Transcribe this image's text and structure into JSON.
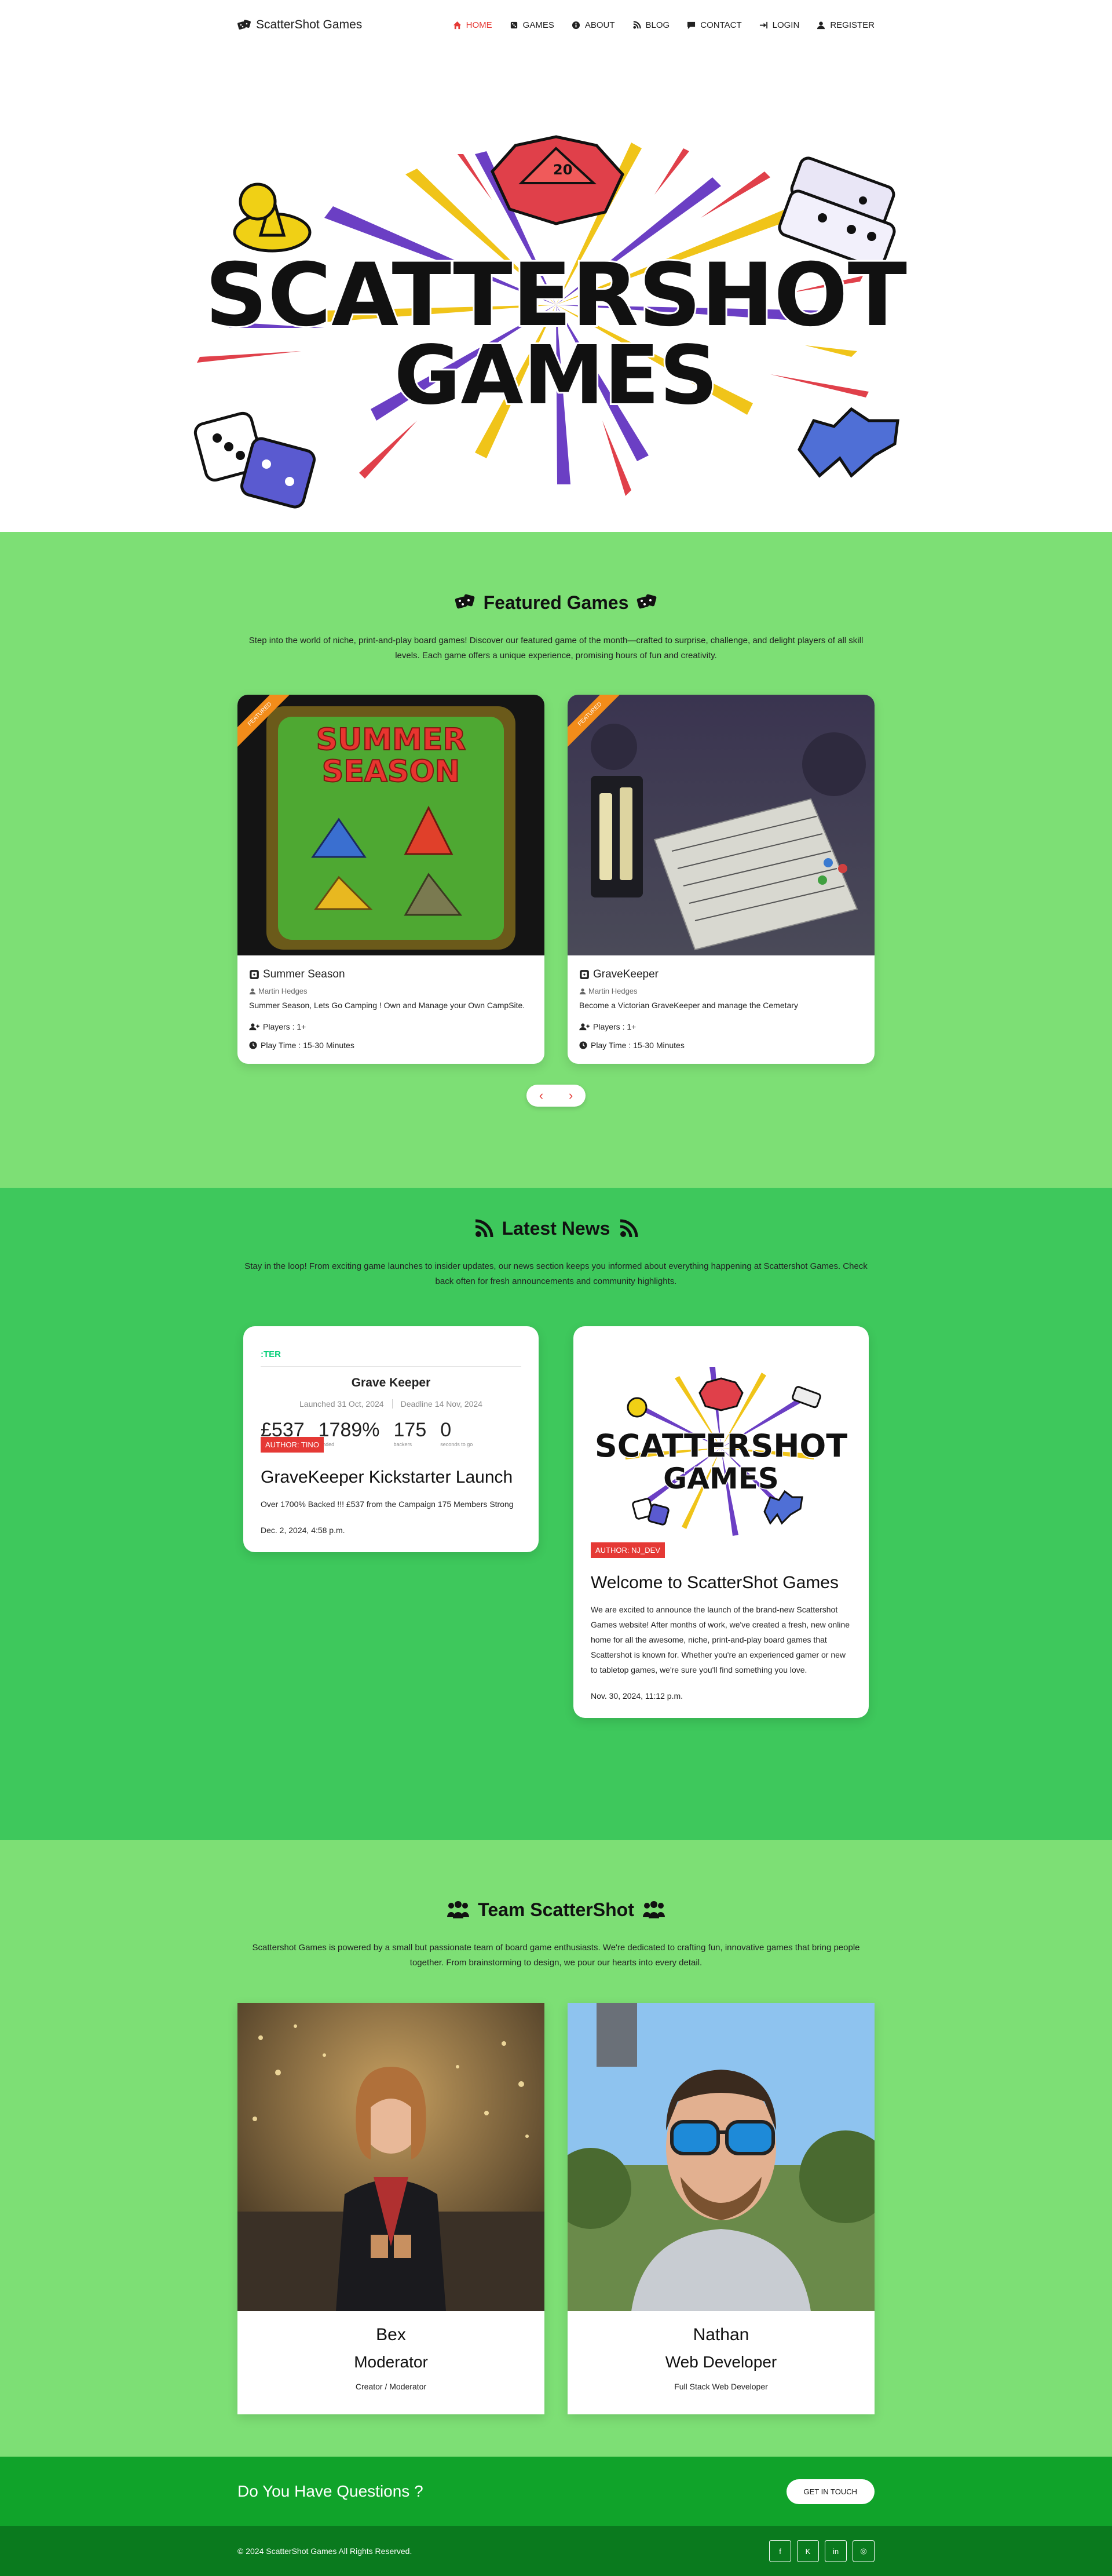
{
  "nav": {
    "brand": "ScatterShot Games",
    "links": [
      {
        "label": "HOME",
        "icon": "home-icon",
        "active": true
      },
      {
        "label": "GAMES",
        "icon": "dice-icon"
      },
      {
        "label": "ABOUT",
        "icon": "info-icon"
      },
      {
        "label": "BLOG",
        "icon": "blog-icon"
      },
      {
        "label": "CONTACT",
        "icon": "message-icon"
      },
      {
        "label": "LOGIN",
        "icon": "login-icon"
      },
      {
        "label": "REGISTER",
        "icon": "user-icon"
      }
    ]
  },
  "hero": {
    "logo_line1": "SCATTERSHOT",
    "logo_line2": "GAMES"
  },
  "featured": {
    "title": "Featured Games",
    "description": "Step into the world of niche, print-and-play board games! Discover our featured game of the month—crafted to surprise, challenge, and delight players of all skill levels. Each game offers a unique experience, promising hours of fun and creativity.",
    "cards": [
      {
        "ribbon": "FEATURED",
        "title": "Summer Season",
        "author": "Martin Hedges",
        "description": "Summer Season, Lets Go Camping ! Own and Manage your Own CampSite.",
        "players": "Players : 1+",
        "playtime": "Play Time : 15-30 Minutes",
        "art_line1": "SUMMER",
        "art_line2": "SEASON"
      },
      {
        "ribbon": "FEATURED",
        "title": "GraveKeeper",
        "author": "Martin Hedges",
        "description": "Become a Victorian GraveKeeper and manage the Cemetary",
        "players": "Players : 1+",
        "playtime": "Play Time : 15-30 Minutes"
      }
    ],
    "prev": "‹",
    "next": "›"
  },
  "news": {
    "title": "Latest News",
    "description": "Stay in the loop! From exciting game launches to insider updates, our news section keeps you informed about everything happening at Scattershot Games. Check back often for fresh announcements and community highlights.",
    "items": [
      {
        "badge": "AUTHOR: TINO",
        "title": "GraveKeeper Kickstarter Launch",
        "text": "Over 1700% Backed !!! £537 from the Campaign 175 Members Strong",
        "date": "Dec. 2, 2024, 4:58 p.m.",
        "ks_logo": ":TER",
        "ks_title": "Grave Keeper",
        "ks_launched": "Launched 31 Oct, 2024",
        "ks_deadline": "Deadline 14 Nov, 2024",
        "ks_stats": [
          {
            "value": "£537",
            "label": "pledged"
          },
          {
            "value": "1789%",
            "label": "funded"
          },
          {
            "value": "175",
            "label": "backers"
          },
          {
            "value": "0",
            "label": "seconds to go"
          }
        ]
      },
      {
        "badge": "AUTHOR: NJ_DEV",
        "title": "Welcome to ScatterShot Games",
        "text": "We are excited to announce the launch of the brand-new Scattershot Games website! After months of work, we've created a fresh, new online home for all the awesome, niche, print-and-play board games that Scattershot is known for. Whether you're an experienced gamer or new to tabletop games, we're sure you'll find something you love.",
        "date": "Nov. 30, 2024, 11:12 p.m.",
        "logo_line1": "SCATTERSHOT",
        "logo_line2": "GAMES"
      }
    ]
  },
  "team": {
    "title": "Team ScatterShot",
    "description": "Scattershot Games is powered by a small but passionate team of board game enthusiasts. We're dedicated to crafting fun, innovative games that bring people together. From brainstorming to design, we pour our hearts into every detail.",
    "members": [
      {
        "name": "Bex",
        "role": "Moderator",
        "sub": "Creator / Moderator"
      },
      {
        "name": "Nathan",
        "role": "Web Developer",
        "sub": "Full Stack Web Developer"
      }
    ]
  },
  "cta": {
    "title": "Do You Have Questions ?",
    "button": "GET IN TOUCH"
  },
  "footer": {
    "copyright": "© 2024 ScatterShot Games All Rights Reserved.",
    "socials": [
      {
        "icon": "facebook-icon",
        "glyph": "f"
      },
      {
        "icon": "kickstarter-icon",
        "glyph": "K"
      },
      {
        "icon": "linkedin-icon",
        "glyph": "in"
      },
      {
        "icon": "instagram-icon",
        "glyph": "◎"
      }
    ]
  },
  "colors": {
    "accent_red": "#e53935",
    "light_green": "#7ddf75",
    "mid_green": "#3ec85c",
    "dark_green": "#10a32a",
    "footer_green": "#0a7a1e",
    "ribbon_orange": "#f28c1a",
    "burst_purple": "#6b3fc4",
    "burst_yellow": "#f0c419",
    "burst_red": "#e0404a"
  }
}
